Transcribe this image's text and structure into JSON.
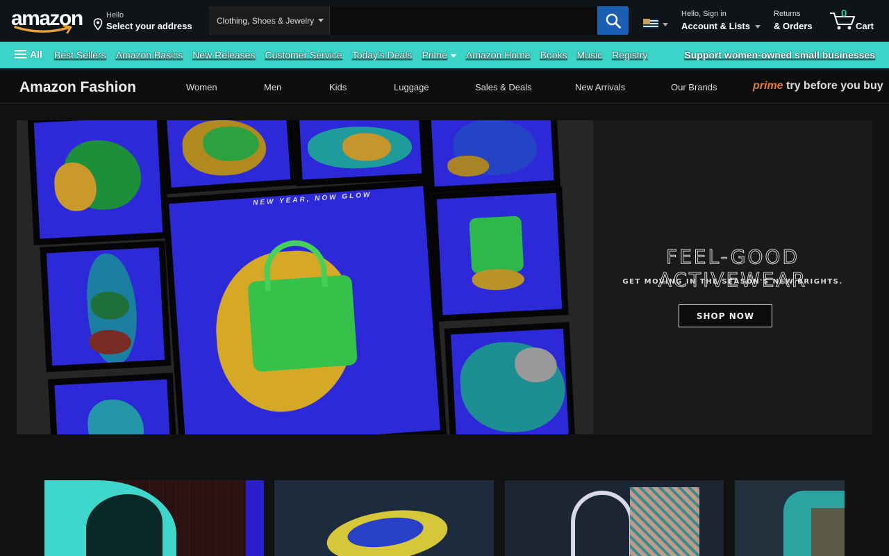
{
  "header": {
    "logo_text": "amazon",
    "location": {
      "hello": "Hello",
      "select": "Select your address"
    },
    "search": {
      "category": "Clothing, Shoes & Jewelry",
      "value": "",
      "placeholder": ""
    },
    "account": {
      "line1": "Hello, Sign in",
      "line2": "Account & Lists"
    },
    "returns": {
      "line1": "Returns",
      "line2": "& Orders"
    },
    "cart": {
      "count": "0",
      "label": "Cart"
    }
  },
  "nav": {
    "all_label": "All",
    "items": [
      "Best Sellers",
      "Amazon Basics",
      "New Releases",
      "Customer Service",
      "Today's Deals",
      "Prime",
      "Amazon Home",
      "Books",
      "Music",
      "Registry"
    ],
    "promo": "Support women-owned small businesses"
  },
  "fashion_nav": {
    "brand": "Amazon Fashion",
    "links": [
      "Women",
      "Men",
      "Kids",
      "Luggage",
      "Sales & Deals",
      "New Arrivals",
      "Our Brands"
    ],
    "prime_word": "prime",
    "prime_tagline": "try before you buy"
  },
  "hero": {
    "caption": "NEW YEAR, NOW GLOW",
    "title": "FEEL-GOOD ACTIVEWEAR",
    "subtitle": "GET MOVING IN THE SEASON'S NEW BRIGHTS.",
    "button": "SHOP NOW"
  },
  "colors": {
    "header_bg": "#0f1419",
    "nav_bg": "#3ad4c9",
    "search_button": "#1a5fb4",
    "tile_blue": "#2d28d8",
    "cart_count": "#2fc6a8",
    "prime_orange": "#e07a3a"
  }
}
